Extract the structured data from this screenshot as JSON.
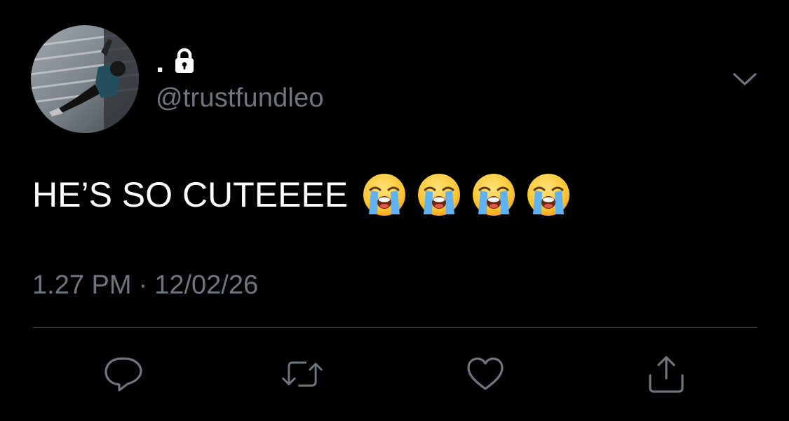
{
  "tweet": {
    "display_name": ".",
    "protected": true,
    "handle": "@trustfundleo",
    "text": "HE’S SO CUTEEEE",
    "emojis": [
      "loudly-crying-face",
      "loudly-crying-face",
      "loudly-crying-face",
      "loudly-crying-face"
    ],
    "time": "1.27 PM",
    "separator": "·",
    "date": "12/02/26"
  },
  "actions": [
    {
      "name": "reply",
      "icon": "speech-bubble-icon"
    },
    {
      "name": "retweet",
      "icon": "retweet-icon"
    },
    {
      "name": "like",
      "icon": "heart-icon"
    },
    {
      "name": "share",
      "icon": "share-icon"
    }
  ],
  "colors": {
    "background": "#000000",
    "primary_text": "#ffffff",
    "secondary_text": "#6e767d",
    "divider": "#2f3336",
    "icon": "#6e767d"
  }
}
